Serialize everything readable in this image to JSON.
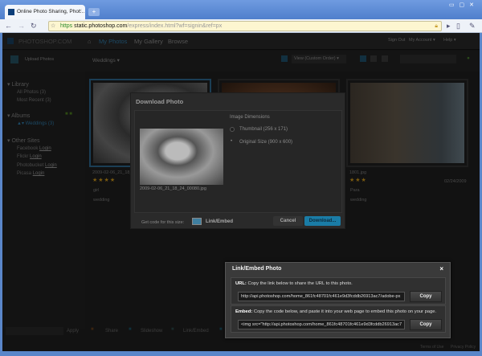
{
  "browser": {
    "tab_title": "Online Photo Sharing, Phot...",
    "url_scheme": "https",
    "url_host": "static.photoshop.com",
    "url_path": "/express/index.html?wf=signin&ref=px"
  },
  "nav": {
    "logo": "PHOTOSHOP.COM",
    "items": [
      "My Photos",
      "My Gallery",
      "Browse"
    ],
    "right": [
      "Sign Out",
      "My Account ▾",
      "Help ▾"
    ]
  },
  "subbar": {
    "upload": "Upload Photos",
    "album": "Weddings ▾",
    "view": "View (Custom Order) ▾"
  },
  "sidebar": {
    "library": "Library",
    "library_items": [
      "All Photos (3)",
      "Most Recent (3)"
    ],
    "albums": "Albums",
    "album_item": "Weddings (3)",
    "other_sites": "Other Sites",
    "sites": [
      "Facebook",
      "Flickr",
      "Photobucket",
      "Picasa"
    ],
    "login": "Login"
  },
  "photos": [
    {
      "name": "2009-02-06_21_18_...",
      "stars": 4,
      "date": "",
      "tags": [
        "girl",
        "wedding"
      ]
    },
    {
      "name": "",
      "stars": 0,
      "date": "",
      "tags": []
    },
    {
      "name": "1801.jpg",
      "stars": 3,
      "date": "02/24/2009",
      "tags": [
        "Para",
        "wedding"
      ]
    }
  ],
  "download_dialog": {
    "title": "Download Photo",
    "dimensions_label": "Image Dimensions",
    "options": [
      "Thumbnail (256 x 171)",
      "Original Size (900 x 600)"
    ],
    "selected": 1,
    "filename": "2009-02-06_21_18_24_00080.jpg",
    "get_code": "Get code for this size:",
    "link_embed": "Link/Embed",
    "cancel": "Cancel",
    "download": "Download..."
  },
  "link_dialog": {
    "title": "Link/Embed Photo",
    "close": "×",
    "url_label": "URL:",
    "url_desc": "Copy the link below to share the URL to this photo.",
    "url_value": "http://api.photoshop.com/home_861fc48701fc461e9d3fcddb26913ac7/adobe-px",
    "embed_label": "Embed:",
    "embed_desc": "Copy the code below, and paste it into your web page to embed this photo on your page.",
    "embed_value": "<img src=\"http://api.photoshop.com/home_861fc48701fc461e9d3fcddb26913ac7",
    "copy": "Copy"
  },
  "bottom": {
    "apply": "Apply",
    "share": "Share",
    "slideshow": "Slideshow",
    "link_embed": "Link/Embed",
    "terms": "Terms of Use",
    "privacy": "Privacy Policy"
  },
  "colors": {
    "accent": "#1a9fd6",
    "star": "#e0a020"
  }
}
